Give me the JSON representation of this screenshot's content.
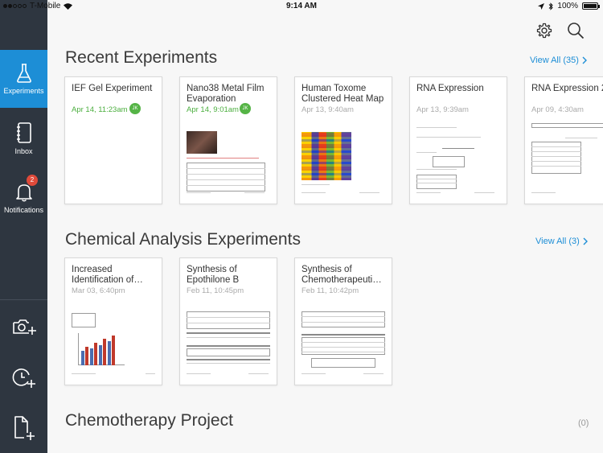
{
  "status_bar": {
    "carrier": "T-Mobile",
    "time": "9:14 AM",
    "battery": "100%"
  },
  "sidebar": {
    "items": [
      {
        "label": "Experiments",
        "icon": "flask-icon",
        "active": true
      },
      {
        "label": "Inbox",
        "icon": "notebook-icon",
        "active": false
      },
      {
        "label": "Notifications",
        "icon": "bell-icon",
        "active": false,
        "badge": "2"
      }
    ],
    "actions": [
      {
        "icon": "camera-add-icon"
      },
      {
        "icon": "clock-add-icon"
      },
      {
        "icon": "document-add-icon"
      }
    ]
  },
  "header": {
    "settings_icon": "gear-icon",
    "search_icon": "search-icon"
  },
  "sections": [
    {
      "title": "Recent Experiments",
      "view_all": "View All (35)",
      "cards": [
        {
          "title": "IEF Gel Experiment",
          "date": "Apr 14, 11:23am",
          "date_color": "#4caf3f",
          "avatar": "JK"
        },
        {
          "title": "Nano38 Metal Film Evaporation",
          "date": "Apr 14, 9:01am",
          "date_color": "#4caf3f",
          "avatar": "JK"
        },
        {
          "title": "Human Toxome Clustered Heat Map",
          "date": "Apr 13, 9:40am"
        },
        {
          "title": "RNA Expression",
          "date": "Apr 13, 9:39am"
        },
        {
          "title": "RNA Expression 2",
          "date": "Apr 09, 4:30am"
        }
      ]
    },
    {
      "title": "Chemical Analysis Experiments",
      "view_all": "View All (3)",
      "cards": [
        {
          "title": "Increased Identification of…",
          "date": "Mar 03, 6:40pm"
        },
        {
          "title": "Synthesis of Epothilone B",
          "date": "Feb 11, 10:45pm"
        },
        {
          "title": "Synthesis of Chemotherapeuti…",
          "date": "Feb 11, 10:42pm"
        }
      ]
    },
    {
      "title": "Chemotherapy Project",
      "count": "(0)"
    }
  ],
  "colors": {
    "sidebar_bg": "#2e3640",
    "accent": "#1d8ed6",
    "recent_date_green": "#4caf3f",
    "badge_red": "#e04a3a"
  }
}
